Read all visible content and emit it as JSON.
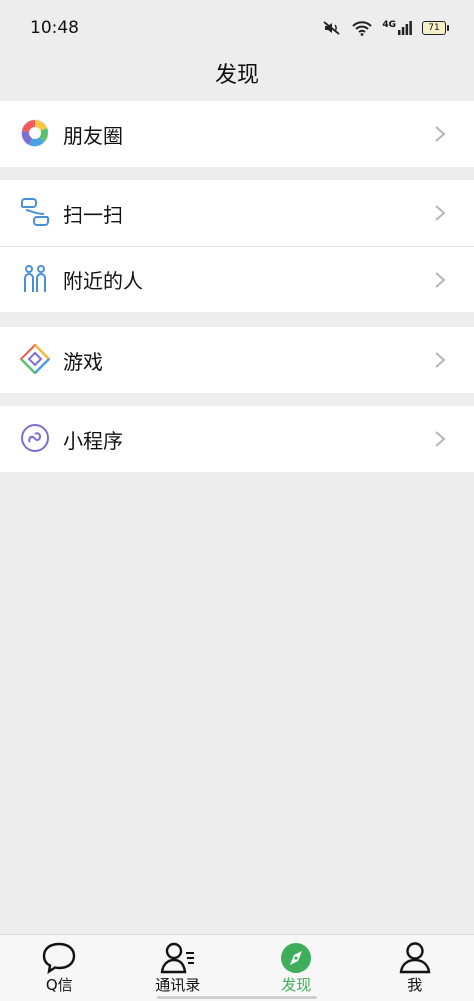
{
  "status_bar": {
    "time": "10:48",
    "network": "4G",
    "battery": "71"
  },
  "header": {
    "title": "发现"
  },
  "groups": [
    {
      "items": [
        {
          "label": "朋友圈",
          "icon": "moments-icon"
        }
      ]
    },
    {
      "items": [
        {
          "label": "扫一扫",
          "icon": "scan-icon"
        },
        {
          "label": "附近的人",
          "icon": "people-nearby-icon"
        }
      ]
    },
    {
      "items": [
        {
          "label": "游戏",
          "icon": "game-icon"
        }
      ]
    },
    {
      "items": [
        {
          "label": "小程序",
          "icon": "mini-program-icon"
        }
      ]
    }
  ],
  "tabbar": {
    "tabs": [
      {
        "label": "Q信",
        "icon": "chat-bubble-icon",
        "active": false
      },
      {
        "label": "通讯录",
        "icon": "contacts-icon",
        "active": false
      },
      {
        "label": "发现",
        "icon": "compass-icon",
        "active": true
      },
      {
        "label": "我",
        "icon": "person-icon",
        "active": false
      }
    ]
  },
  "colors": {
    "accent": "#3fae5a",
    "background": "#ededed"
  }
}
